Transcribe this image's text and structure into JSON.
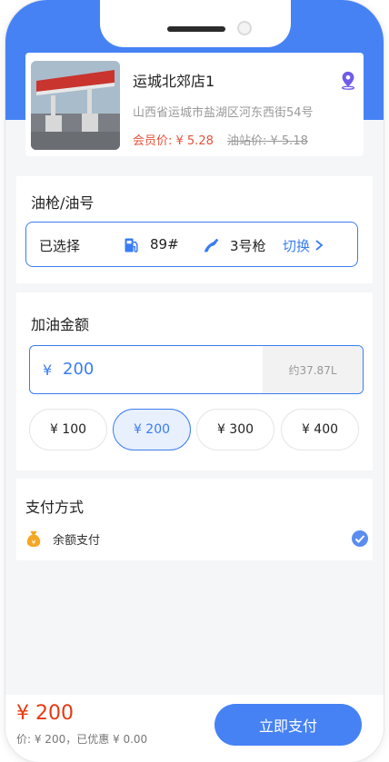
{
  "station": {
    "name": "运城北郊店1",
    "address": "山西省运城市盐湖区河东西街54号",
    "member_price": "会员价: ¥ 5.28",
    "station_price": "油站价: ¥ 5.18"
  },
  "fuel_section": {
    "title": "油枪/油号",
    "selected_label": "已选择",
    "fuel_grade": "89#",
    "gun": "3号枪",
    "switch_label": "切换"
  },
  "amount_section": {
    "title": "加油金额",
    "currency": "¥",
    "amount": "200",
    "litres": "约37.87L",
    "presets": [
      {
        "label": "¥ 100",
        "active": false
      },
      {
        "label": "¥ 200",
        "active": true
      },
      {
        "label": "¥ 300",
        "active": false
      },
      {
        "label": "¥ 400",
        "active": false
      }
    ]
  },
  "payment_section": {
    "title": "支付方式",
    "method": "余额支付",
    "selected": true
  },
  "bottom_bar": {
    "total": "¥ 200",
    "detail": "价: ¥ 200，已优惠 ¥ 0.00",
    "pay_button": "立即支付"
  },
  "colors": {
    "primary": "#4682f4",
    "accent_blue": "#3a7df2",
    "price_red": "#e8503a",
    "total_red": "#e8390f"
  }
}
